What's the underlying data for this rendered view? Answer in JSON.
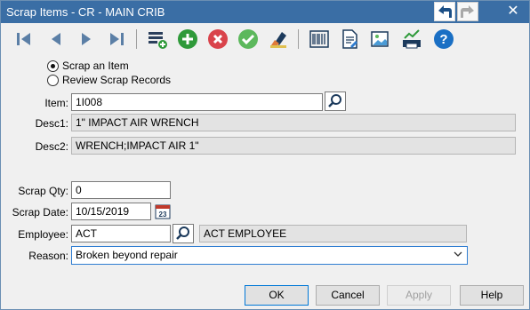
{
  "window": {
    "title": "Scrap Items - CR - MAIN CRIB"
  },
  "mode": {
    "scrap_item_label": "Scrap an Item",
    "review_label": "Review Scrap Records",
    "selected": "scrap_item"
  },
  "item": {
    "label": "Item:",
    "value": "1I008",
    "desc1_label": "Desc1:",
    "desc1_value": "1\" IMPACT AIR WRENCH",
    "desc2_label": "Desc2:",
    "desc2_value": "WRENCH;IMPACT AIR 1\""
  },
  "scrap": {
    "qty_label": "Scrap Qty:",
    "qty_value": "0",
    "date_label": "Scrap Date:",
    "date_value": "10/15/2019",
    "calendar_day": "23",
    "employee_label": "Employee:",
    "employee_value": "ACT",
    "employee_name": "ACT EMPLOYEE",
    "reason_label": "Reason:",
    "reason_value": "Broken beyond repair"
  },
  "buttons": {
    "ok": "OK",
    "cancel": "Cancel",
    "apply": "Apply",
    "help": "Help"
  },
  "colors": {
    "titlebar": "#3a6ea5",
    "nav_arrows": "#5b7fa6",
    "add_green": "#2f9a3a",
    "delete_red": "#d9434b",
    "confirm_green": "#5cb85c",
    "help_blue": "#1a6fc4"
  },
  "icons": [
    "back-arrow-icon",
    "forward-arrow-icon",
    "close-icon",
    "first-record-icon",
    "previous-record-icon",
    "next-record-icon",
    "last-record-icon",
    "new-list-icon",
    "add-icon",
    "delete-icon",
    "confirm-icon",
    "clear-icon",
    "barcode-icon",
    "document-icon",
    "picture-icon",
    "print-chart-icon",
    "help-icon",
    "search-icon",
    "calendar-icon",
    "chevron-down-icon"
  ]
}
